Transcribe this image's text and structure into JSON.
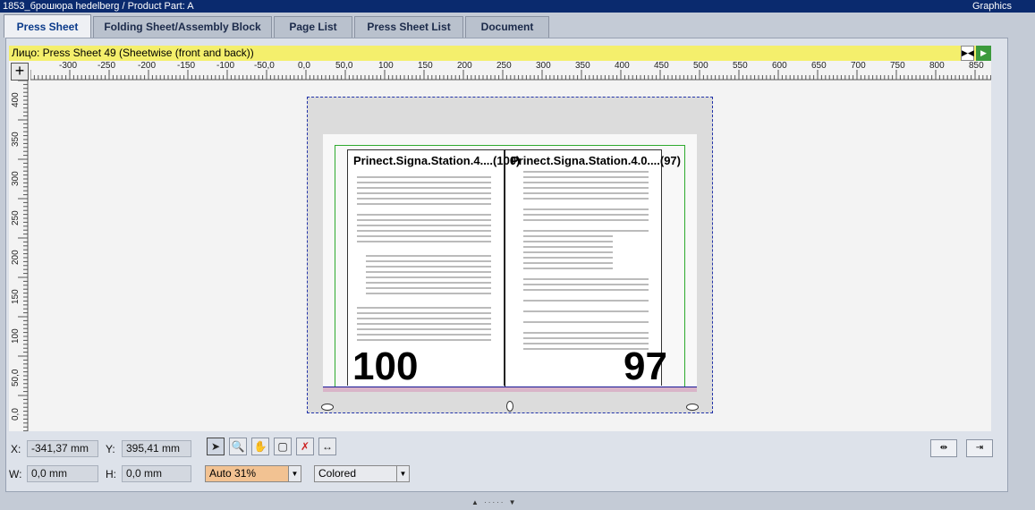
{
  "window": {
    "title": "1853_брошюра hedelberg / Product Part: A",
    "right_label": "Graphics"
  },
  "tabs": [
    {
      "label": "Press Sheet",
      "active": true
    },
    {
      "label": "Folding Sheet/Assembly Block",
      "active": false
    },
    {
      "label": "Page List",
      "active": false
    },
    {
      "label": "Press Sheet List",
      "active": false
    },
    {
      "label": "Document",
      "active": false
    }
  ],
  "sheet_bar": {
    "label": "Лицо:",
    "value": "Press Sheet 49 (Sheetwise (front and back))"
  },
  "hruler": [
    "-300",
    "-250",
    "-200",
    "-150",
    "-100",
    "-50,0",
    "0,0",
    "50,0",
    "100",
    "150",
    "200",
    "250",
    "300",
    "350",
    "400",
    "450",
    "500",
    "550",
    "600",
    "650",
    "700",
    "750",
    "800",
    "850"
  ],
  "vruler": [
    "400",
    "350",
    "300",
    "250",
    "200",
    "150",
    "100",
    "50,0",
    "0,0"
  ],
  "pages": [
    {
      "title": "Prinect.Signa.Station.4....(100)",
      "number": "100"
    },
    {
      "title": "Prinect.Signa.Station.4.0....(97)",
      "number": "97"
    }
  ],
  "coords": {
    "x_label": "X:",
    "x_value": "-341,37 mm",
    "y_label": "Y:",
    "y_value": "395,41 mm",
    "w_label": "W:",
    "w_value": "0,0 mm",
    "h_label": "H:",
    "h_value": "0,0 mm"
  },
  "tools": [
    {
      "name": "select-tool-icon",
      "glyph": "➤"
    },
    {
      "name": "zoom-tool-icon",
      "glyph": "🔍"
    },
    {
      "name": "hand-tool-icon",
      "glyph": "✋"
    },
    {
      "name": "frame-tool-icon",
      "glyph": "▢"
    },
    {
      "name": "delete-tool-icon",
      "glyph": "✗"
    },
    {
      "name": "measure-tool-icon",
      "glyph": "↔"
    }
  ],
  "zoom": {
    "value": "Auto 31%"
  },
  "color_mode": {
    "value": "Colored"
  },
  "colors": {
    "title_bar": "#0a2a6e",
    "tab_active": "#0a3a8a",
    "sheet_bar": "#f4ef6c",
    "frame": "#2eaa2e",
    "outline": "#2233aa"
  }
}
